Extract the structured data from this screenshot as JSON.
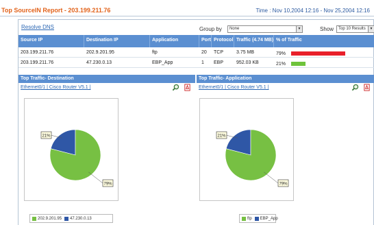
{
  "header": {
    "title": "Top SourceIN Report - 203.199.211.76",
    "time_range": "Time : Nov 10,2004 12:16 - Nov 25,2004 12:16"
  },
  "toolbar": {
    "resolve_dns": "Resolve DNS",
    "group_by_label": "Group by",
    "group_by_value": "None",
    "show_label": "Show",
    "show_value": "Top 10 Results"
  },
  "table": {
    "columns": [
      "Source IP",
      "Destination IP",
      "Application",
      "Port",
      "Protocol",
      "Traffic (4.74 MB)",
      "% of Traffic"
    ],
    "rows": [
      {
        "source": "203.199.211.76",
        "dest": "202.9.201.95",
        "app": "ftp",
        "port": "20",
        "protocol": "TCP",
        "traffic": "3.75 MB",
        "pct_label": "79%",
        "pct": 79,
        "color": "#e8202a"
      },
      {
        "source": "203.199.211.76",
        "dest": "47.230.0.13",
        "app": "EBP_App",
        "port": "1",
        "protocol": "EBP",
        "traffic": "952.03 KB",
        "pct_label": "21%",
        "pct": 21,
        "color": "#6ec33b"
      }
    ]
  },
  "left_section": {
    "title": "Top Traffic- Destination",
    "subtitle": "Ethernet0/1 | Cisco Router V5.1 |"
  },
  "right_section": {
    "title": "Top Traffic- Application",
    "subtitle": "Ethernet0/1 | Cisco Router V5.1 |"
  },
  "icons": {
    "zoom": "magnifier-icon",
    "pdf": "pdf-export-icon"
  },
  "colors": {
    "header_blue": "#5b8fd1",
    "title_orange": "#e2621a",
    "green": "#77c043",
    "blue": "#2f57a6",
    "red": "#e8202a"
  },
  "chart_data": [
    {
      "type": "pie",
      "labels": [
        "202.9.201.95",
        "47.230.0.13"
      ],
      "values": [
        79,
        21
      ],
      "data_labels": [
        "79%",
        "21%"
      ],
      "colors": [
        "#77c043",
        "#2f57a6"
      ]
    },
    {
      "type": "pie",
      "labels": [
        "ftp",
        "EBP_App"
      ],
      "values": [
        79,
        21
      ],
      "data_labels": [
        "79%",
        "21%"
      ],
      "colors": [
        "#77c043",
        "#2f57a6"
      ]
    }
  ]
}
